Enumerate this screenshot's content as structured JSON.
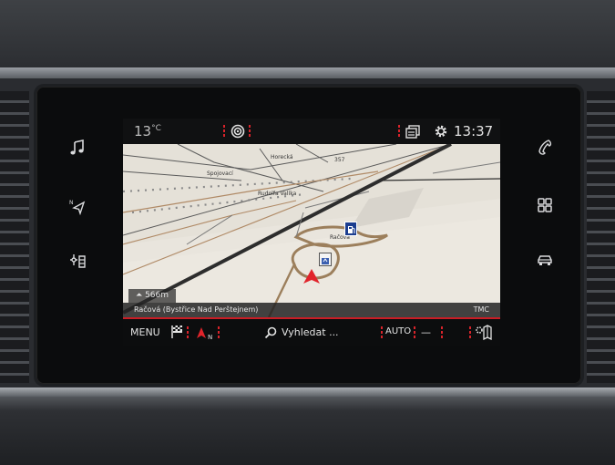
{
  "status_bar": {
    "temperature_value": "13",
    "temperature_unit": "°C",
    "time": "13:37",
    "icons": [
      "connectivity-icon",
      "pages-icon",
      "settings-gear-icon"
    ]
  },
  "left_buttons": [
    "music-icon",
    "navigation-icon",
    "climate-fan-icon"
  ],
  "right_buttons": [
    "phone-icon",
    "apps-grid-icon",
    "car-icon"
  ],
  "map": {
    "street_labels": [
      "Horecká",
      "357",
      "Spojovací",
      "Rudolfa Valíka",
      "Račová"
    ],
    "distance_to_next": "566m",
    "current_address": "Račová (Bystřice Nad Perštejnem)",
    "traffic_label": "TMC"
  },
  "bottom_bar": {
    "menu_label": "MENU",
    "search_label": "Vyhledat ...",
    "zoom_mode": "AUTO",
    "zoom_out_label": "—"
  },
  "colors": {
    "accent": "#d8232a",
    "map_background": "#e9e5dd",
    "route": "#9c7f5c"
  }
}
